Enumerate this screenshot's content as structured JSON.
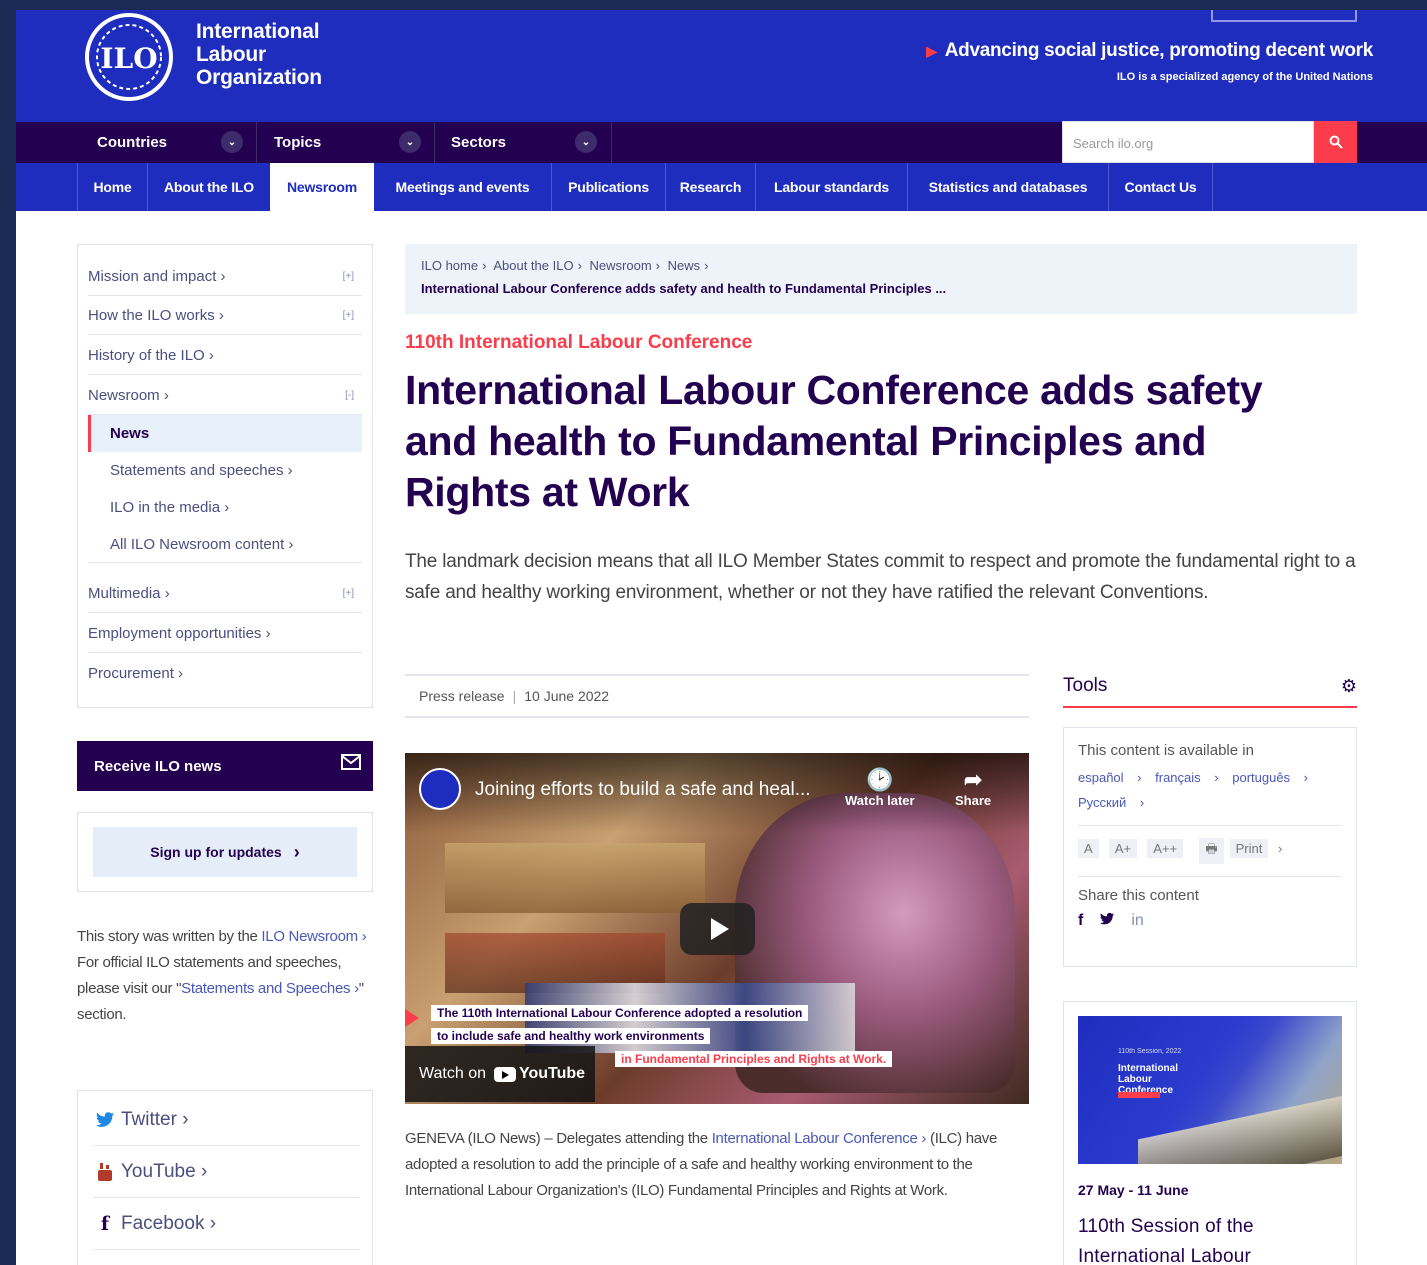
{
  "header": {
    "logo_lines": [
      "International",
      "Labour",
      "Organization"
    ],
    "logo_emblem_text": "ILO",
    "tagline": "Advancing social justice, promoting decent work",
    "subtagline": "ILO is a specialized agency of the United Nations"
  },
  "nav_primary": {
    "items": [
      "Countries",
      "Topics",
      "Sectors"
    ],
    "search_placeholder": "Search ilo.org"
  },
  "nav_secondary": {
    "items": [
      "Home",
      "About the ILO",
      "Newsroom",
      "Meetings and events",
      "Publications",
      "Research",
      "Labour standards",
      "Statistics and databases",
      "Contact Us"
    ],
    "active": "Newsroom"
  },
  "sidebar": {
    "items": [
      {
        "label": "Mission and impact",
        "toggle": "[+]"
      },
      {
        "label": "How the ILO works",
        "toggle": "[+]"
      },
      {
        "label": "History of the ILO",
        "toggle": ""
      },
      {
        "label": "Newsroom",
        "toggle": "[-]"
      }
    ],
    "sub_items": [
      "News",
      "Statements and speeches",
      "ILO in the media",
      "All ILO Newsroom content"
    ],
    "items_after": [
      {
        "label": "Multimedia",
        "toggle": "[+]"
      },
      {
        "label": "Employment opportunities",
        "toggle": ""
      },
      {
        "label": "Procurement",
        "toggle": ""
      }
    ],
    "receive_news": "Receive ILO news",
    "signup": "Sign up for updates",
    "story": {
      "p1": "This story was written by the ",
      "link1": "ILO Newsroom",
      "p2": " For official ILO statements and speeches, please visit our \"",
      "link2": "Statements and Speeches",
      "p3": "\" section."
    },
    "social": [
      "Twitter",
      "YouTube",
      "Facebook"
    ]
  },
  "breadcrumb": {
    "path": [
      "ILO home",
      "About the ILO",
      "Newsroom",
      "News"
    ],
    "current": "International Labour Conference adds safety and health to Fundamental Principles ..."
  },
  "article": {
    "kicker": "110th International Labour Conference",
    "title": "International Labour Conference adds safety and health to Fundamental Principles and Rights at Work",
    "lede": "The landmark decision means that all ILO Member States commit to respect and promote the fundamental right to a safe and healthy working environment, whether or not they have ratified the relevant Conventions.",
    "type": "Press release",
    "date": "10 June 2022",
    "video": {
      "title": "Joining efforts to build a safe and heal...",
      "watch_later": "Watch later",
      "share": "Share",
      "caption1": "The 110th International Labour Conference adopted a resolution",
      "caption2": "to include safe and healthy work environments",
      "caption3": "in Fundamental Principles and Rights at Work.",
      "watch_on": "Watch on",
      "youtube": "YouTube"
    },
    "body": {
      "p1": "GENEVA (ILO News) – Delegates attending the ",
      "link": "International Labour Conference",
      "p2": " (ILC) have adopted a resolution to add the principle of a safe and healthy working environment to the International Labour Organization's (ILO) Fundamental Principles and Rights at Work."
    }
  },
  "tools": {
    "heading": "Tools",
    "available_in": "This content is available in",
    "languages": [
      "español",
      "français",
      "português",
      "Русский"
    ],
    "font_sizes": [
      "A",
      "A+",
      "A++"
    ],
    "print": "Print",
    "share_label": "Share this content",
    "share_icons": [
      "f",
      "t",
      "in"
    ]
  },
  "event": {
    "image_caption_small": "110th Session, 2022",
    "image_caption": [
      "International",
      "Labour",
      "Conference"
    ],
    "date": "27 May - 11 June",
    "title": "110th Session of the International Labour"
  },
  "colors": {
    "ilo_blue": "#1e2dbe",
    "ilo_purple": "#230050",
    "ilo_red": "#fa3c4b"
  }
}
